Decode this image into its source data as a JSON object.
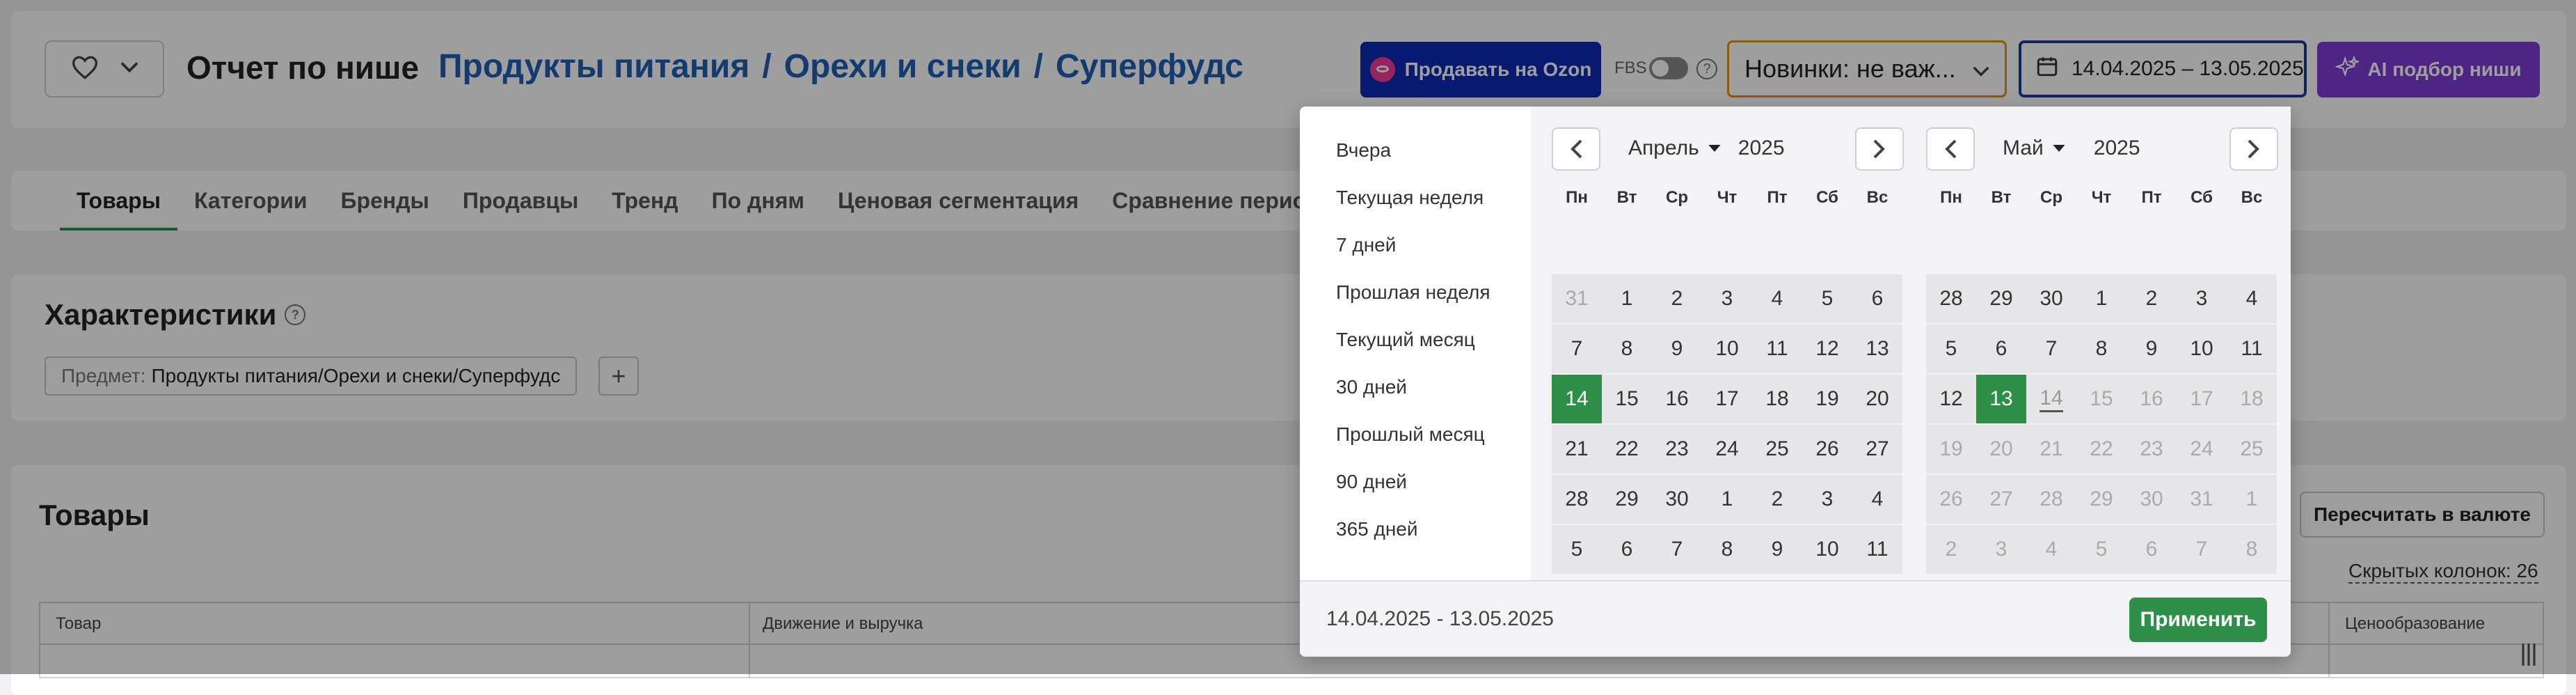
{
  "header": {
    "title": "Отчет по нише",
    "breadcrumbs": [
      "Продукты питания",
      "Орехи и снеки",
      "Суперфудс"
    ],
    "ozon_button": "Продавать на Ozon",
    "fbs_label": "FBS",
    "help_glyph": "?",
    "novelty_select": "Новинки: не важ...",
    "date_range": "14.04.2025 – 13.05.2025",
    "ai_button": "AI подбор ниши"
  },
  "tabs": [
    "Товары",
    "Категории",
    "Бренды",
    "Продавцы",
    "Тренд",
    "По дням",
    "Ценовая сегментация",
    "Сравнение периодов"
  ],
  "characteristics": {
    "title": "Характеристики",
    "chip_label": "Предмет:",
    "chip_value": "Продукты питания/Орехи и снеки/Суперфудс",
    "add_glyph": "+"
  },
  "products": {
    "title": "Товары",
    "recalc_button": "Пересчитать в валюте",
    "hidden_columns": "Скрытых колонок: 26",
    "columns": [
      "Товар",
      "Движение и выручка",
      "Ценообразование"
    ]
  },
  "datepicker": {
    "presets": [
      "Вчера",
      "Текущая неделя",
      "7 дней",
      "Прошлая неделя",
      "Текущий месяц",
      "30 дней",
      "Прошлый месяц",
      "90 дней",
      "365 дней"
    ],
    "weekdays": [
      "Пн",
      "Вт",
      "Ср",
      "Чт",
      "Пт",
      "Сб",
      "Вс"
    ],
    "left": {
      "month": "Апрель",
      "year": "2025",
      "days": [
        [
          "31",
          "1",
          "2",
          "3",
          "4",
          "5",
          "6"
        ],
        [
          "7",
          "8",
          "9",
          "10",
          "11",
          "12",
          "13"
        ],
        [
          "14",
          "15",
          "16",
          "17",
          "18",
          "19",
          "20"
        ],
        [
          "21",
          "22",
          "23",
          "24",
          "25",
          "26",
          "27"
        ],
        [
          "28",
          "29",
          "30",
          "1",
          "2",
          "3",
          "4"
        ],
        [
          "5",
          "6",
          "7",
          "8",
          "9",
          "10",
          "11"
        ]
      ]
    },
    "right": {
      "month": "Май",
      "year": "2025",
      "days": [
        [
          "28",
          "29",
          "30",
          "1",
          "2",
          "3",
          "4"
        ],
        [
          "5",
          "6",
          "7",
          "8",
          "9",
          "10",
          "11"
        ],
        [
          "12",
          "13",
          "14",
          "15",
          "16",
          "17",
          "18"
        ],
        [
          "19",
          "20",
          "21",
          "22",
          "23",
          "24",
          "25"
        ],
        [
          "26",
          "27",
          "28",
          "29",
          "30",
          "31",
          "1"
        ],
        [
          "2",
          "3",
          "4",
          "5",
          "6",
          "7",
          "8"
        ]
      ]
    },
    "footer_range": "14.04.2025 - 13.05.2025",
    "apply_button": "Применить",
    "colors": {
      "selected": "#2d8f48",
      "accent_blue": "#1f5fb4"
    }
  }
}
